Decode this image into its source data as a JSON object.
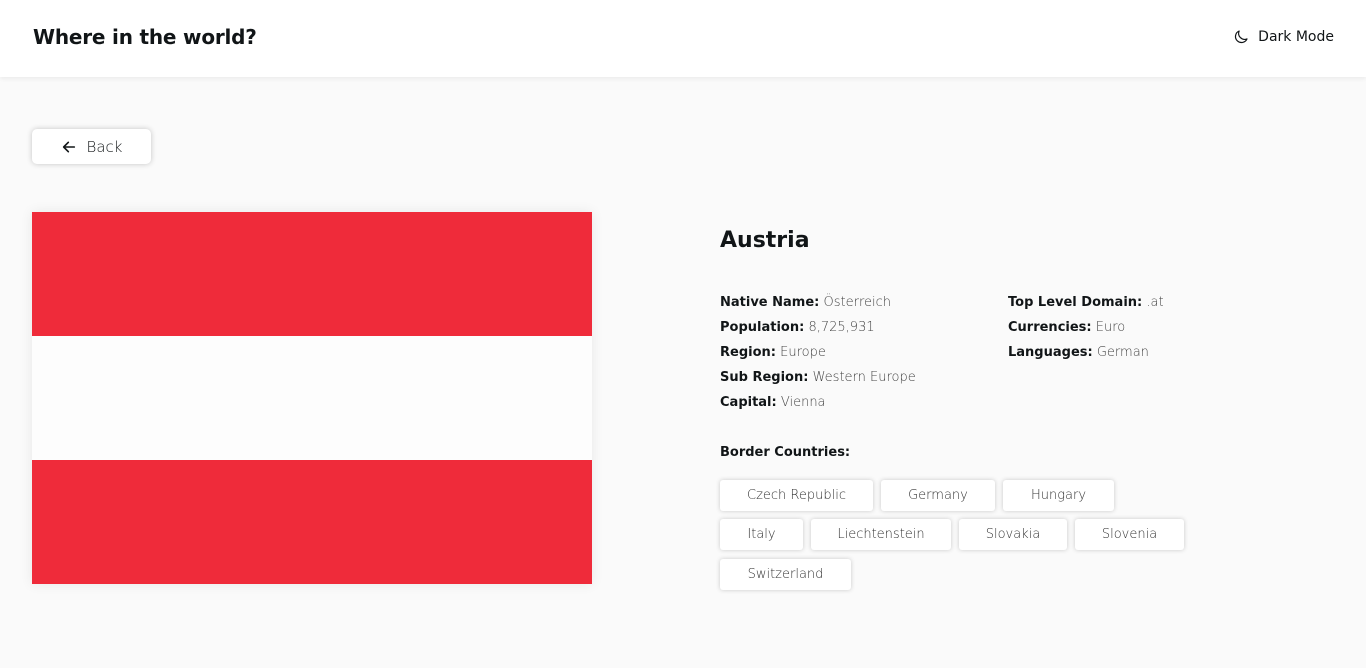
{
  "header": {
    "title": "Where in the world?",
    "mode_label": "Dark Mode",
    "mode_icon": "moon-icon"
  },
  "back": {
    "label": "Back",
    "icon": "arrow-left-icon"
  },
  "flag": {
    "colors": [
      "#ef2b3a",
      "#fdfdfd",
      "#ef2b3a"
    ]
  },
  "country": {
    "name": "Austria",
    "details_left": [
      {
        "label": "Native Name:",
        "value": "Österreich"
      },
      {
        "label": "Population:",
        "value": "8,725,931"
      },
      {
        "label": "Region:",
        "value": "Europe"
      },
      {
        "label": "Sub Region:",
        "value": "Western Europe"
      },
      {
        "label": "Capital:",
        "value": "Vienna"
      }
    ],
    "details_right": [
      {
        "label": "Top Level Domain:",
        "value": ".at"
      },
      {
        "label": "Currencies:",
        "value": "Euro"
      },
      {
        "label": "Languages:",
        "value": "German"
      }
    ],
    "border_label": "Border Countries:",
    "borders": [
      "Czech Republic",
      "Germany",
      "Hungary",
      "Italy",
      "Liechtenstein",
      "Slovakia",
      "Slovenia",
      "Switzerland"
    ]
  }
}
